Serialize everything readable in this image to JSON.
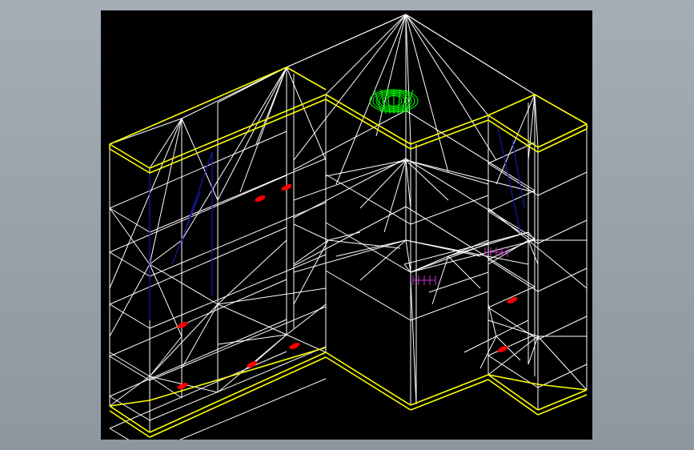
{
  "viewer": {
    "background": "#000000",
    "surround": "#9ba3ad"
  },
  "model": {
    "description_colors": {
      "outline": "#ffffff",
      "top_and_base_rims": "#ffff00",
      "back_braces": "#1a1aaa",
      "handles": "#ff0000",
      "fixtures": "#cc33cc",
      "ceiling_lamp": "#00ff00"
    }
  }
}
